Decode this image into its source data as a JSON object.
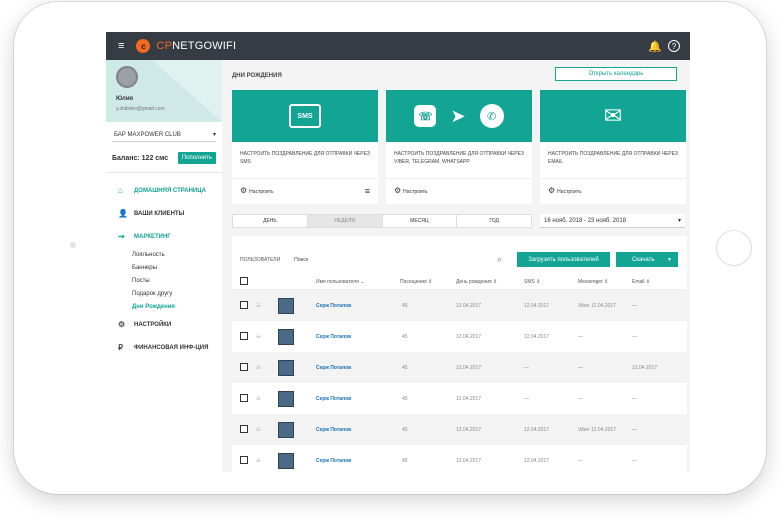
{
  "app": {
    "brand_prefix": "CP",
    "brand_name": "NETGOWIFI"
  },
  "topbar": {
    "help_icon": "?"
  },
  "sidebar": {
    "user_name": "Юлия",
    "user_email": "y.shibeko@gmail.com",
    "club": "БАР MAXPOWER CLUB",
    "balance": "Баланс: 122 смс",
    "topup_label": "Пополнить",
    "nav": [
      {
        "label": "ДОМАШНЯЯ СТРАНИЦА",
        "icon": "home-icon"
      },
      {
        "label": "ВАШИ КЛИЕНТЫ",
        "icon": "user-icon"
      },
      {
        "label": "МАРКЕТИНГ",
        "icon": "share-icon"
      },
      {
        "label": "НАСТРОЙКИ",
        "icon": "gear-icon"
      },
      {
        "label": "ФИНАНСОВАЯ ИНФ-ЦИЯ",
        "icon": "ruble-icon"
      }
    ],
    "sub": [
      "Лояльность",
      "Баннеры",
      "Посты",
      "Подарок другу",
      "Дни Рождения"
    ]
  },
  "main": {
    "title": "ДНИ РОЖДЕНИЯ",
    "calendar_button": "Открыть календарь",
    "cards": [
      {
        "hero_text": "SMS",
        "text": "НАСТРОИТЬ ПОЗДРАВЛЕНИЕ ДЛЯ ОТПРАВКИ ЧЕРЕЗ SMS",
        "settings": "Настроить"
      },
      {
        "text": "НАСТРОИТЬ ПОЗДРАВЛЕНИЕ ДЛЯ ОТПРАВКИ ЧЕРЕЗ VIBER, TELEGRAM, WHATSAPP",
        "settings": "Настроить"
      },
      {
        "text": "НАСТРОИТЬ ПОЗДРАВЛЕНИЕ ДЛЯ ОТПРАВКИ ЧЕРЕЗ EMAIL",
        "settings": "Настроить"
      }
    ],
    "tabs": [
      "ДЕНЬ",
      "НЕДЕЛЯ",
      "МЕСЯЦ",
      "ГОД"
    ],
    "date_range": "16 нояб. 2018 - 23 нояб. 2018",
    "table": {
      "users_label": "ПОЛЬЗОВАТЕЛИ",
      "search_placeholder": "Поиск",
      "upload_label": "Загрузить пользователей",
      "download_label": "Скачать",
      "columns": [
        "Имя пользователя",
        "Посещения",
        "День рождения",
        "SMS",
        "Messenger",
        "Email"
      ],
      "rows": [
        {
          "name": "Серж Потапов",
          "visits": "45",
          "birthday": "12.04.2017",
          "sms": "12.04.2017",
          "messenger": "Viber 12.04.2017",
          "email": "—"
        },
        {
          "name": "Серж Потапов",
          "visits": "45",
          "birthday": "12.04.2017",
          "sms": "12.04.2017",
          "messenger": "—",
          "email": "—"
        },
        {
          "name": "Серж Потапов",
          "visits": "45",
          "birthday": "12.04.2017",
          "sms": "—",
          "messenger": "—",
          "email": "12.04.2017"
        },
        {
          "name": "Серж Потапов",
          "visits": "45",
          "birthday": "12.04.2017",
          "sms": "—",
          "messenger": "—",
          "email": "—"
        },
        {
          "name": "Серж Потапов",
          "visits": "45",
          "birthday": "12.04.2017",
          "sms": "12.04.2017",
          "messenger": "Viber 12.04.2017",
          "email": "—"
        },
        {
          "name": "Серж Потапов",
          "visits": "45",
          "birthday": "12.04.2017",
          "sms": "12.04.2017",
          "messenger": "—",
          "email": "—"
        }
      ]
    }
  },
  "colors": {
    "accent": "#12a594",
    "topbar": "#353c43",
    "brand_orange": "#f26a21"
  }
}
